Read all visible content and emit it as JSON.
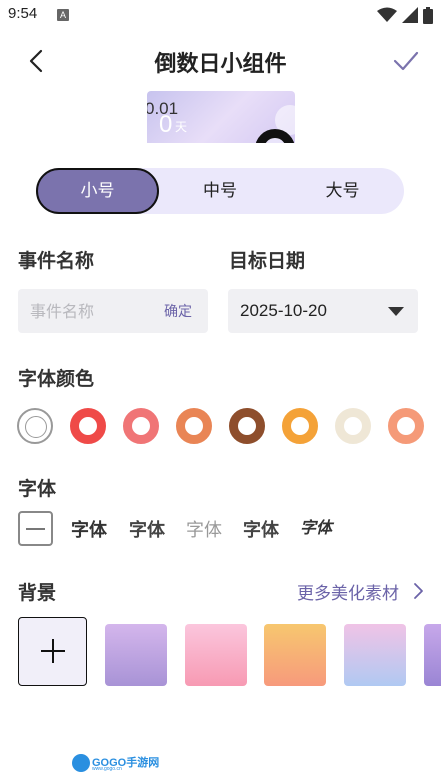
{
  "status_bar": {
    "time": "9:54",
    "notification_letter": "A",
    "icons": [
      "wifi-icon",
      "signal-icon",
      "battery-icon"
    ]
  },
  "header": {
    "title": "倒数日小组件",
    "back_icon": "chevron-left-icon",
    "confirm_icon": "check-icon",
    "accent_color": "#7b73ad"
  },
  "preview": {
    "date_text": "0.01",
    "days_value": "0",
    "days_unit": "天"
  },
  "size_options": {
    "items": [
      "小号",
      "中号",
      "大号"
    ],
    "selected": "小号"
  },
  "event_name": {
    "label": "事件名称",
    "placeholder": "事件名称",
    "value": "",
    "confirm_label": "确定"
  },
  "target_date": {
    "label": "目标日期",
    "value": "2025-10-20"
  },
  "font_color": {
    "label": "字体颜色",
    "colors": [
      "none",
      "#ef4a48",
      "#f07576",
      "#e98555",
      "#8e4e2c",
      "#f4a238",
      "#efe7d6",
      "#f59a78"
    ]
  },
  "font": {
    "label": "字体",
    "options": [
      "字体",
      "字体",
      "字体",
      "字体",
      "字体"
    ]
  },
  "background": {
    "label": "背景",
    "more_label": "更多美化素材",
    "tiles": [
      "purple-gradient",
      "pink-gradient",
      "orange-gradient",
      "lavender-blue-gradient",
      "purple-partial"
    ]
  },
  "watermark": {
    "text": "GOGO手游网",
    "sub": "www.gogo.cn"
  }
}
